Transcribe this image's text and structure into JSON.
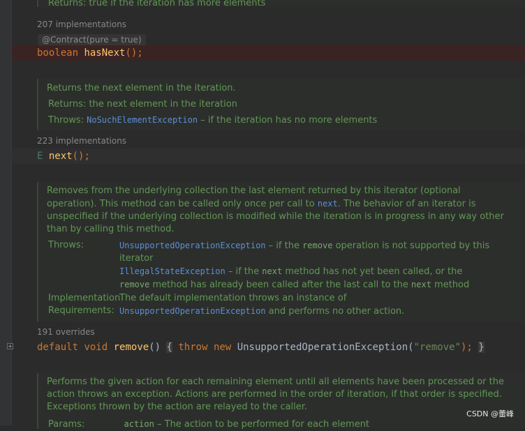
{
  "top_cut_text": "Returns: true if the iteration has more elements",
  "hasNext": {
    "impl_count": "207 implementations",
    "annotation": "@Contract(pure = true)",
    "kw_boolean": "boolean",
    "name": "hasNext",
    "rest": "();"
  },
  "next_doc": {
    "summary": "Returns the next element in the iteration.",
    "returns_label": "Returns:",
    "returns_value": "the next element in the iteration",
    "throws_label": "Throws:",
    "throws_exception": "NoSuchElementException",
    "throws_rest": " – if the iteration has no more elements"
  },
  "next": {
    "impl_count": "223 implementations",
    "type": "E",
    "name": "next",
    "rest": "();"
  },
  "remove_doc": {
    "line1": "Removes from the underlying collection the last element returned by this iterator (optional",
    "line2_a": "operation). This method can be called only once per call to ",
    "line2_code": "next",
    "line2_b": ". The behavior of an iterator is",
    "line3": "unspecified if the underlying collection is modified while the iteration is in progress in any way other",
    "line4": "than by calling this method.",
    "throws_label": "Throws:",
    "t1_exception": "UnsupportedOperationException",
    "t1_a": " – if the ",
    "t1_code": "remove",
    "t1_b": " operation is not supported by this",
    "t1_c": "iterator",
    "t2_exception": "IllegalStateException",
    "t2_a": " – if the ",
    "t2_code": "next",
    "t2_b": " method has not yet been called, or the",
    "t2_code2": "remove",
    "t2_c": " method has already been called after the last call to the ",
    "t2_code3": "next",
    "t2_d": " method",
    "impl_label_1": "Implementation",
    "impl_label_2": "Requirements:",
    "impl_value_1": "The default implementation throws an instance of",
    "impl_exception": "UnsupportedOperationException",
    "impl_value_2": " and performs no other action."
  },
  "remove": {
    "override_count": "191 overrides",
    "kw_default": "default",
    "kw_void": "void",
    "name": "remove",
    "paren": "()",
    "brace_open": "{",
    "kw_throw": "throw",
    "kw_new": "new",
    "exception": "UnsupportedOperationException",
    "arg_open": "(",
    "arg": "\"remove\"",
    "arg_close": ");",
    "brace_close": "}"
  },
  "forEach_doc": {
    "line1": "Performs the given action for each remaining element until all elements have been processed or the",
    "line2": "action throws an exception. Actions are performed in the order of iteration, if that order is specified.",
    "line3": "Exceptions thrown by the action are relayed to the caller.",
    "params_label": "Params:",
    "params_code": "action",
    "params_rest": " – The action to be performed for each element"
  },
  "watermark": "CSDN @蕾峰"
}
